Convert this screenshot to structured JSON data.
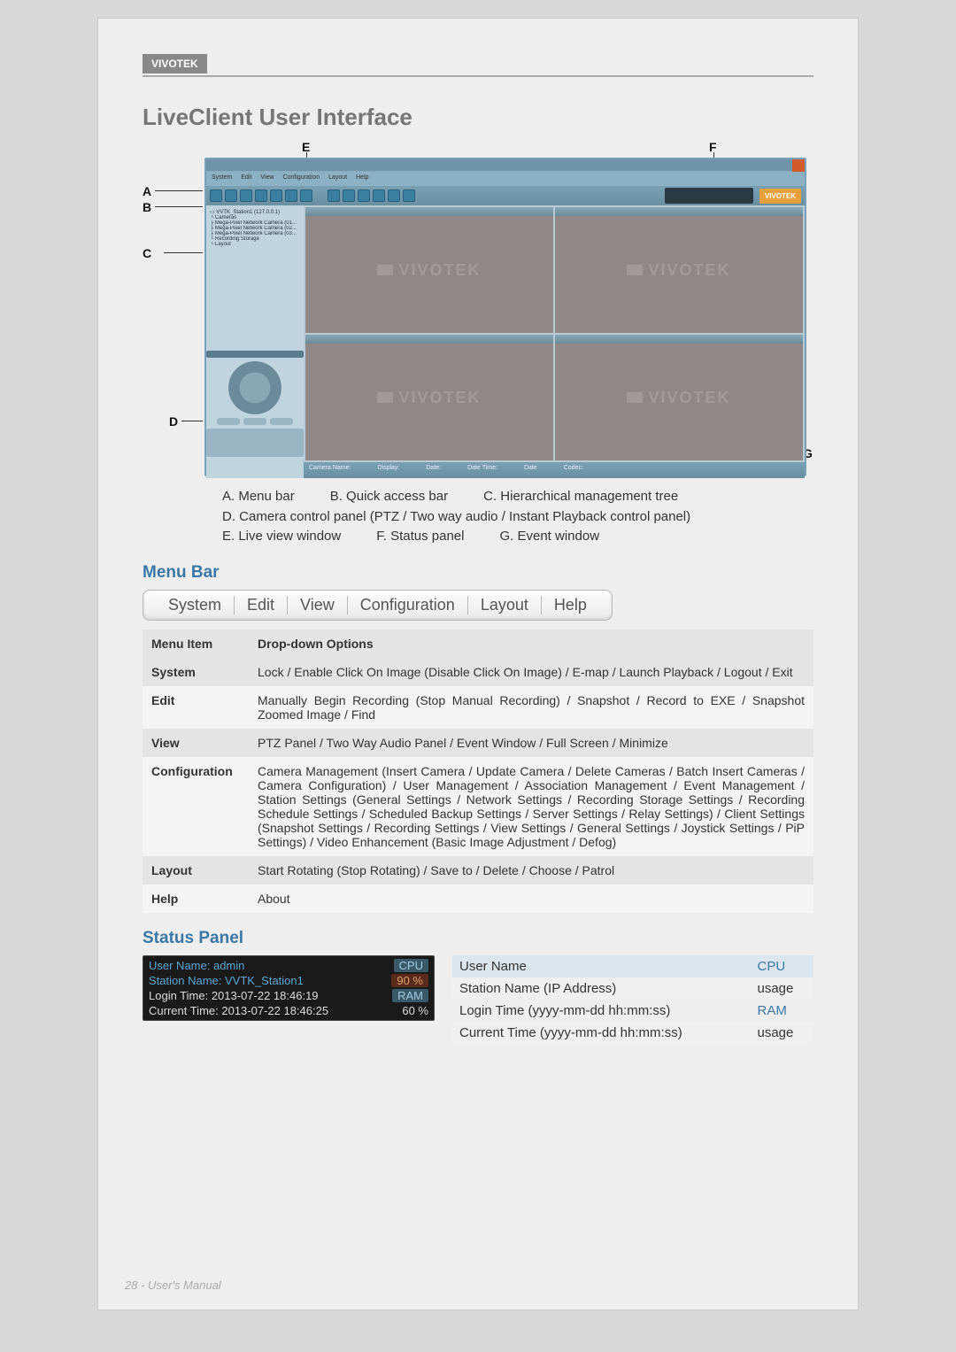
{
  "brand": "VIVOTEK",
  "title": "LiveClient User Interface",
  "diagram": {
    "labels": {
      "A": "A",
      "B": "B",
      "C": "C",
      "D": "D",
      "E": "E",
      "F": "F",
      "G": "G"
    },
    "menubar_items": [
      "System",
      "Edit",
      "View",
      "Configuration",
      "Layout",
      "Help"
    ],
    "sidebar_tree": [
      "▭ VVTK_Station1 (127.0.0.1)",
      " └ Cameras",
      "   ├ Mega-Pixel Network Camera (01...",
      "   ├ Mega-Pixel Network Camera (02...",
      "   ├ Mega-Pixel Network Camera (03...",
      "   └ Recording Storage",
      " └ Layout"
    ],
    "watermark": "VIVOTEK",
    "footbar_items": [
      "Camera Name:",
      "Display:",
      "Date:",
      "Date Time:",
      "Date",
      "Codec:"
    ]
  },
  "legend": {
    "A": "A. Menu bar",
    "B": "B. Quick access bar",
    "C": "C. Hierarchical management tree",
    "D": "D. Camera control panel (PTZ / Two way audio / Instant Playback control panel)",
    "E": "E. Live view window",
    "F": "F. Status panel",
    "G": "G. Event window"
  },
  "menu_bar_heading": "Menu Bar",
  "menubar_strip": [
    "System",
    "Edit",
    "View",
    "Configuration",
    "Layout",
    "Help"
  ],
  "menu_table": {
    "headers": [
      "Menu Item",
      "Drop-down Options"
    ],
    "rows": [
      {
        "k": "System",
        "v": "Lock / Enable Click On Image (Disable Click On Image) / E-map / Launch Playback / Logout / Exit"
      },
      {
        "k": "Edit",
        "v": "Manually Begin Recording (Stop Manual Recording) / Snapshot / Record to EXE / Snapshot Zoomed Image / Find"
      },
      {
        "k": "View",
        "v": "PTZ Panel / Two Way Audio Panel / Event Window / Full Screen / Minimize"
      },
      {
        "k": "Configuration",
        "v": "Camera Management (Insert Camera / Update Camera / Delete Cameras / Batch Insert Cameras / Camera Configuration) / User Management / Association Management / Event Management / Station Settings (General Settings / Network Settings / Recording Storage Settings / Recording Schedule Settings / Scheduled Backup Settings / Server Settings / Relay Settings) / Client Settings (Snapshot Settings / Recording Settings / View Settings / General Settings / Joystick Settings / PiP Settings) / Video Enhancement (Basic Image Adjustment / Defog)"
      },
      {
        "k": "Layout",
        "v": "Start Rotating (Stop Rotating) / Save to / Delete / Choose / Patrol"
      },
      {
        "k": "Help",
        "v": "About"
      }
    ]
  },
  "status_panel_heading": "Status Panel",
  "status_box": {
    "rows": [
      {
        "left": "User Name: admin",
        "right": "CPU"
      },
      {
        "left": "Station Name: VVTK_Station1",
        "right": "90 %"
      },
      {
        "left": "Login Time: 2013-07-22 18:46:19",
        "right": "RAM"
      },
      {
        "left": "Current Time: 2013-07-22 18:46:25",
        "right": "60 %"
      }
    ]
  },
  "status_legend": {
    "rows": [
      {
        "l": "User Name",
        "r": "CPU"
      },
      {
        "l": "Station Name (IP Address)",
        "r": "usage"
      },
      {
        "l": "Login Time (yyyy-mm-dd hh:mm:ss)",
        "r": "RAM"
      },
      {
        "l": "Current Time (yyyy-mm-dd hh:mm:ss)",
        "r": "usage"
      }
    ]
  },
  "footer": "28 - User's Manual"
}
